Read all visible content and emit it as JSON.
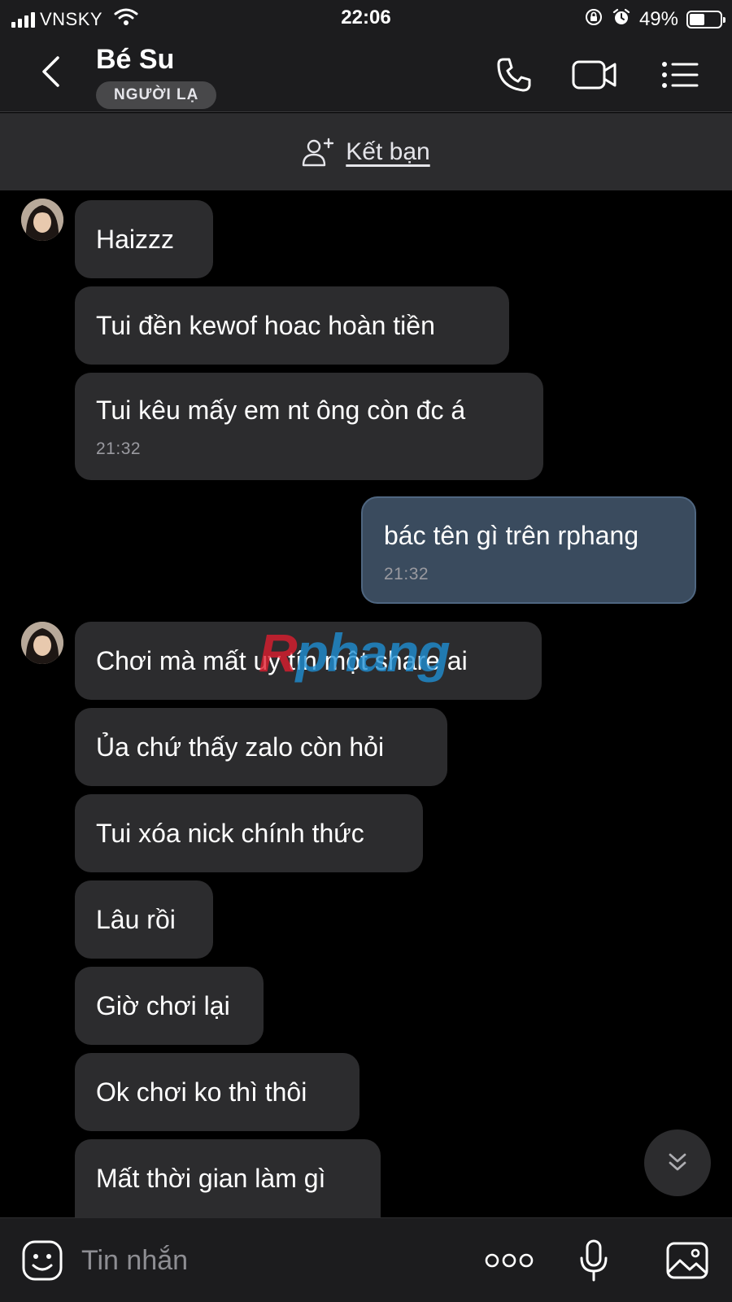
{
  "status_bar": {
    "carrier": "VNSKY",
    "time": "22:06",
    "battery_percent": "49%",
    "battery_level": 0.49
  },
  "header": {
    "contact_name": "Bé Su",
    "badge": "NGƯỜI LẠ",
    "icons": [
      "back-icon",
      "phone-icon",
      "video-call-icon",
      "menu-list-icon"
    ]
  },
  "friend_bar": {
    "label": "Kết bạn",
    "icon": "add-friend-icon"
  },
  "messages": [
    {
      "text": "Haizzz"
    },
    {
      "text": "Tui đền kewof hoac hoàn tiền"
    },
    {
      "text": "Tui kêu mấy em nt ông còn đc á",
      "time": "21:32"
    },
    {
      "text": "bác tên gì trên rphang",
      "time": "21:32",
      "mine": true
    },
    {
      "text": "Chơi mà mất uy tín một share ai"
    },
    {
      "text": "Ủa chứ thấy zalo còn hỏi"
    },
    {
      "text": "Tui xóa nick chính thức"
    },
    {
      "text": "Lâu rồi"
    },
    {
      "text": "Giờ chơi lại"
    },
    {
      "text": "Ok chơi ko thì thôi"
    },
    {
      "text": "Mất thời gian làm gì"
    }
  ],
  "watermark": {
    "text": "Rphang",
    "colors": [
      "#e11d2e",
      "#1e90d6"
    ]
  },
  "input_bar": {
    "placeholder": "Tin nhắn",
    "icons": [
      "sticker-icon",
      "more-icon",
      "microphone-icon",
      "image-icon"
    ]
  },
  "colors": {
    "background": "#000000",
    "bar": "#1c1c1e",
    "bubble_incoming": "#2c2c2e",
    "bubble_outgoing": "#3a4b5e"
  }
}
